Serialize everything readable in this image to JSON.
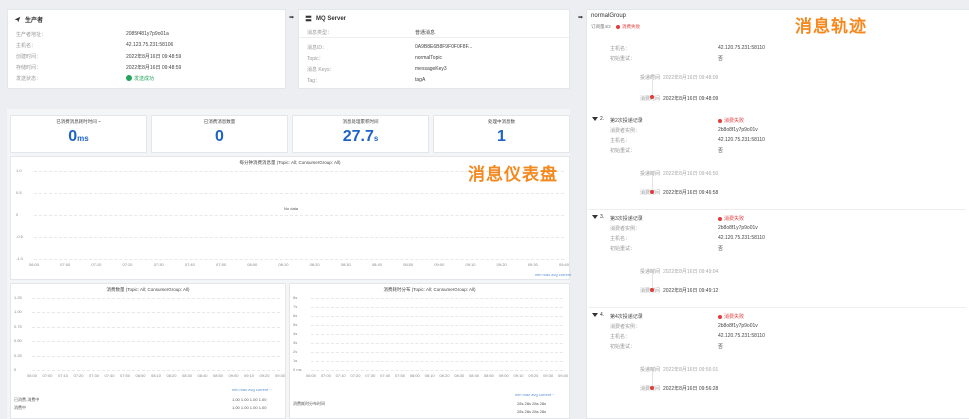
{
  "producer": {
    "title": "生产者",
    "rows": [
      {
        "label": "生产者地址：",
        "value": "2085f481y7p9o01a"
      },
      {
        "label": "主机名：",
        "value": "42.123.75.231:58106"
      },
      {
        "label": "创建时间：",
        "value": "2022年8月16日 09:48:59"
      },
      {
        "label": "存储时间：",
        "value": "2022年8月16日 09:48:59"
      },
      {
        "label": "发送状态：",
        "value": "发送成功"
      }
    ]
  },
  "mq_server": {
    "title": "MQ Server",
    "header_label": "消息类型：",
    "header_value": "普通消息",
    "rows": [
      {
        "label": "消息ID：",
        "value": "0A9B8E6B8F9F0F0F8F..."
      },
      {
        "label": "Topic：",
        "value": "normalTopic"
      },
      {
        "label": "消息 Keys：",
        "value": "messageKey3"
      },
      {
        "label": "Tag：",
        "value": "tagA"
      }
    ]
  },
  "consumer_group": {
    "title": "normalGroup",
    "sub_label": "订阅量4/2",
    "status": "消费失败",
    "colors": {
      "success": "#22a55a",
      "fail": "#e23b3b",
      "accent": "#1f63c6",
      "callout": "#f5891f"
    }
  },
  "callouts": {
    "trace": "消息轨迹",
    "dashboard": "消息仪表盘"
  },
  "kpis": [
    {
      "title": "已消费消息耗时时间 ~",
      "value": "0",
      "unit": "ms"
    },
    {
      "title": "已消费消息数量",
      "value": "0",
      "unit": ""
    },
    {
      "title": "消息处理累积时间",
      "value": "27.7",
      "unit": "s"
    },
    {
      "title": "处理中消息数",
      "value": "1",
      "unit": ""
    }
  ],
  "chart_main": {
    "title": "每分钟消费消息量 (Topic: All; ConsumerGroup: All)",
    "annotation": "No data",
    "yticks": [
      "1.0",
      "0.5",
      "0",
      "-0.5",
      "-1.0"
    ],
    "xticks": [
      "06:00",
      "07:00",
      "07:10",
      "07:20",
      "07:30",
      "07:40",
      "07:50",
      "08:00",
      "08:10",
      "08:20",
      "08:30",
      "08:40",
      "08:50",
      "09:00",
      "09:10",
      "09:20",
      "09:30",
      "09:40"
    ],
    "legend": "min  max  avg  current"
  },
  "chart_left": {
    "title": "消费数量 (Topic: All; ConsumerGroup: All)",
    "yticks": [
      "1.25",
      "1.00",
      "0.75",
      "0.50",
      "0.25",
      "0"
    ],
    "xticks": [
      "06:00",
      "07:00",
      "07:10",
      "07:20",
      "07:30",
      "07:40",
      "07:50",
      "08:00",
      "08:10",
      "08:20",
      "08:30",
      "08:40",
      "08:50",
      "09:00",
      "09:10",
      "09:20",
      "09:30"
    ],
    "legend_head": "min  max  avg  current ~",
    "legend_rows": [
      {
        "name": "已消费-消费中",
        "values": "1.00   1.00   1.00   1.00"
      },
      {
        "name": "消费中",
        "values": "1.00   1.00   1.00   1.00"
      }
    ]
  },
  "chart_right": {
    "title": "消费耗时分布 (Topic: All; ConsumerGroup: All)",
    "yticks": [
      "8s",
      "7s",
      "6s",
      "5s",
      "4s",
      "3s",
      "2s",
      "1s",
      "0 ms"
    ],
    "xticks": [
      "06:00",
      "07:00",
      "07:10",
      "07:20",
      "07:30",
      "07:40",
      "07:50",
      "08:00",
      "08:10",
      "08:20",
      "08:30",
      "08:40",
      "08:50",
      "09:00",
      "09:10",
      "09:20",
      "09:30",
      "09:40"
    ],
    "legend_head": "min  max  avg  current ~",
    "legend_rows": [
      {
        "name": "消费耗时分布时间",
        "values": "28s   28s   28s   28s"
      },
      {
        "name": "",
        "values": "28s   28s   28s   28s"
      }
    ]
  },
  "trace": {
    "first": {
      "host_label": "主机名：",
      "host_value": "42.120.75.231:58110",
      "retry_label": "初始重试：",
      "retry_value": "否",
      "t1_label": "投递时间",
      "t1_value": "2022年8月16日 09:48:09",
      "t2_label": "消费时间",
      "t2_value": "2022年8月16日 09:48:09"
    },
    "items": [
      {
        "idx": "2.",
        "head": "第2次投递记录",
        "status": "消费失败",
        "a_label": "消费者实例：",
        "a_value": "2b8o8f1y7p9o01v",
        "b_label": "主机名：",
        "b_value": "42.120.75.231:58110",
        "c_label": "初始重试：",
        "c_value": "否",
        "t1_label": "投递时间",
        "t1_value": "2022年8月16日 09:46:50",
        "t2_label": "消费时间",
        "t2_value": "2022年8月16日 09:46:58"
      },
      {
        "idx": "3.",
        "head": "第3次投递记录",
        "status": "消费失败",
        "a_label": "消费者实例：",
        "a_value": "2b8o8f1y7p9o01v",
        "b_label": "主机名：",
        "b_value": "42.120.75.231:58110",
        "c_label": "初始重试：",
        "c_value": "否",
        "t1_label": "投递时间",
        "t1_value": "2022年8月16日 09:49:04",
        "t2_label": "消费时间",
        "t2_value": "2022年8月16日 09:49:12"
      },
      {
        "idx": "4.",
        "head": "第4次投递记录",
        "status": "消费失败",
        "a_label": "消费者实例：",
        "a_value": "2b8o8f1y7p9o01v",
        "b_label": "主机名：",
        "b_value": "42.120.75.231:58110",
        "c_label": "初始重试：",
        "c_value": "否",
        "t1_label": "投递时间",
        "t1_value": "2022年8月16日 09:56:01",
        "t2_label": "消费时间",
        "t2_value": "2022年8月16日 09:56:28"
      }
    ]
  }
}
